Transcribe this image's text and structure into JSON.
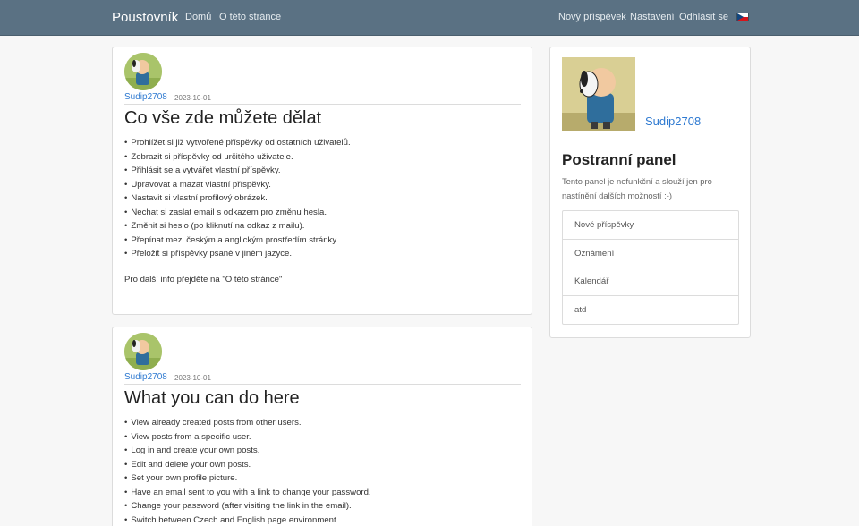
{
  "navbar": {
    "brand": "Poustovník",
    "left_links": [
      "Domů",
      "O této stránce"
    ],
    "right_links": [
      "Nový příspěvek",
      "Nastavení",
      "Odhlásit se"
    ],
    "language_flag": "czech-flag-icon"
  },
  "posts": [
    {
      "author": "Sudip2708",
      "date": "2023-10-01",
      "title": "Co vše zde můžete dělat",
      "items": [
        "Prohlížet si již vytvořené příspěvky od ostatních uživatelů.",
        "Zobrazit si příspěvky od určitého uživatele.",
        "Přihlásit se a vytvářet vlastní příspěvky.",
        "Upravovat a mazat vlastní příspěvky.",
        "Nastavit si vlastní profilový obrázek.",
        "Nechat si zaslat email s odkazem pro změnu hesla.",
        "Změnit si heslo (po kliknutí na odkaz z mailu).",
        "Přepínat mezi českým a anglickým prostředím stránky.",
        "Přeložit si příspěvky psané v jiném jazyce."
      ],
      "footer": "Pro další info přejděte na \"O této stránce\""
    },
    {
      "author": "Sudip2708",
      "date": "2023-10-01",
      "title": "What you can do here",
      "items": [
        "View already created posts from other users.",
        "View posts from a specific user.",
        "Log in and create your own posts.",
        "Edit and delete your own posts.",
        "Set your own profile picture.",
        "Have an email sent to you with a link to change your password.",
        "Change your password (after visiting the link in the email).",
        "Switch between Czech and English page environment."
      ]
    }
  ],
  "sidebar": {
    "username": "Sudip2708",
    "title": "Postranní panel",
    "description": "Tento panel je nefunkční a slouží jen pro nastínění dalších možností :-)",
    "items": [
      "Nové příspěvky",
      "Oznámení",
      "Kalendář",
      "atd"
    ]
  },
  "colors": {
    "navbar": "#5a7183",
    "link": "#2f7ad1",
    "background": "#f7f7f7"
  }
}
